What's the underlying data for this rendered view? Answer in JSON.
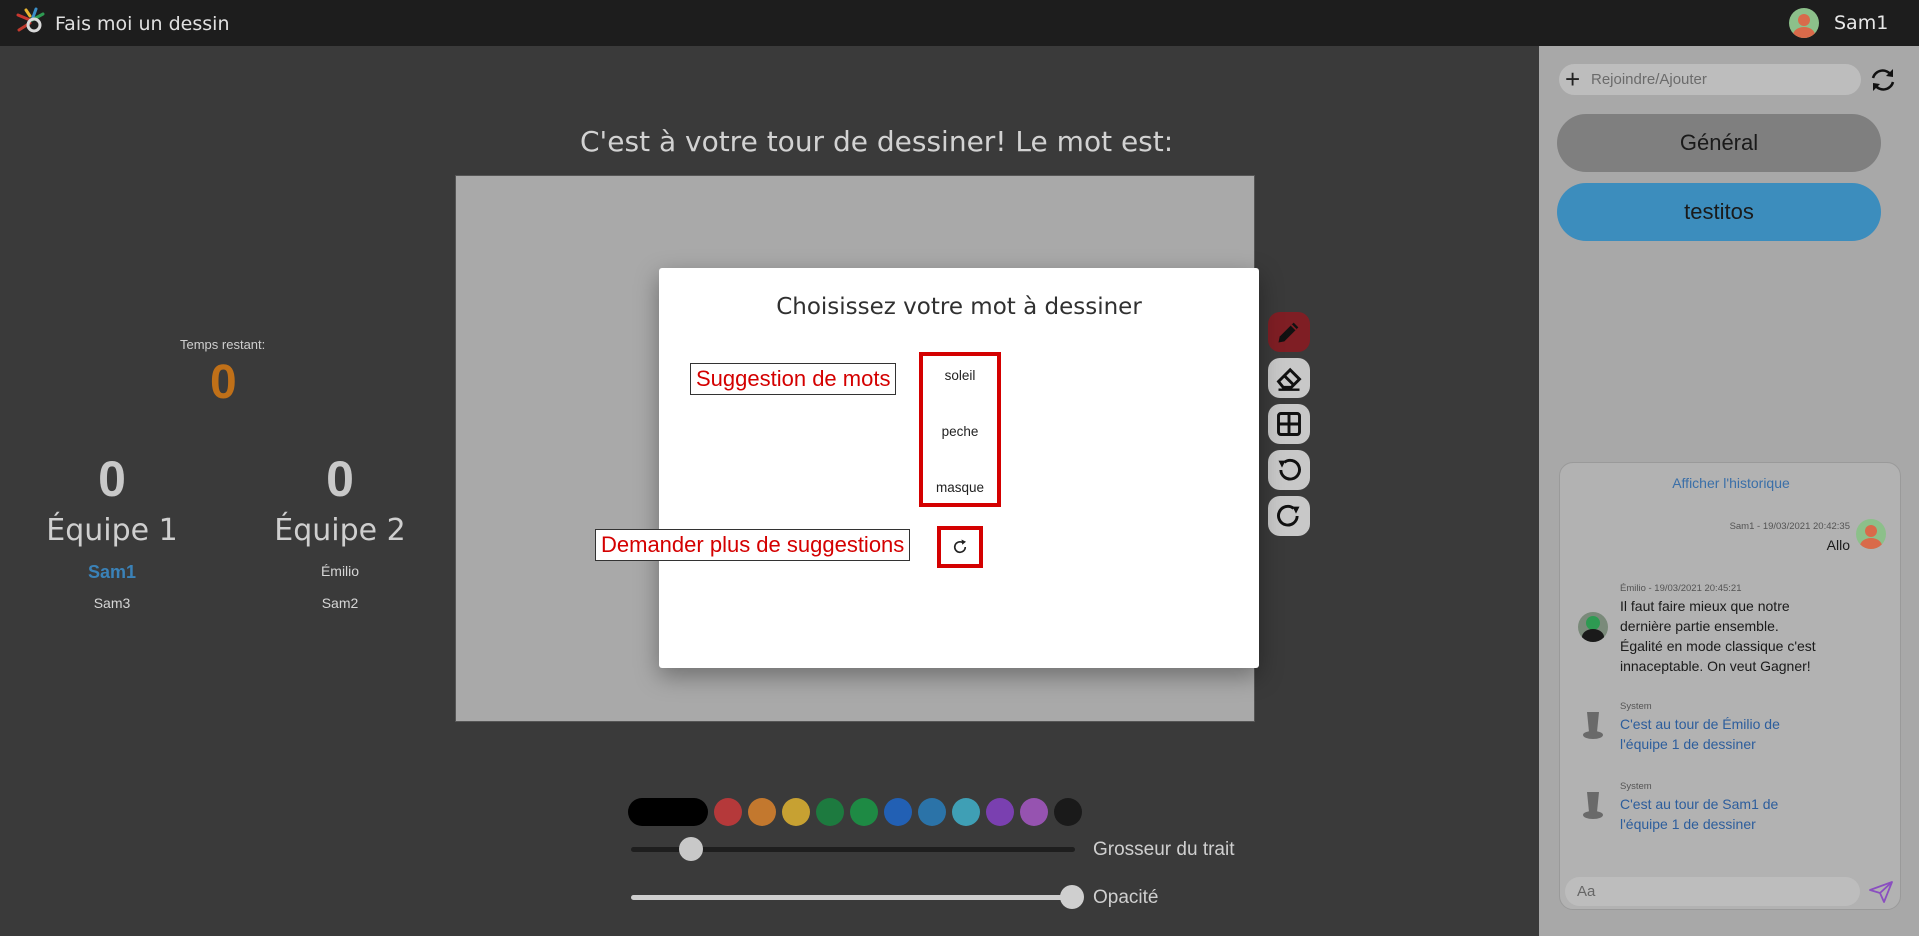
{
  "app": {
    "title": "Fais moi un dessin"
  },
  "user": {
    "name": "Sam1"
  },
  "game": {
    "turn_message": "C'est à votre tour de dessiner! Le mot est:",
    "timer_label": "Temps restant:",
    "timer_value": "0",
    "teams": [
      {
        "score": "0",
        "name": "Équipe 1",
        "players": [
          "Sam1",
          "Sam3"
        ]
      },
      {
        "score": "0",
        "name": "Équipe 2",
        "players": [
          "Émilio",
          "Sam2"
        ]
      }
    ]
  },
  "tools": {
    "items": [
      "pencil-icon",
      "eraser-icon",
      "grid-icon",
      "undo-icon",
      "redo-icon"
    ],
    "active": "pencil-icon"
  },
  "palette": {
    "colors": [
      "#000000",
      "#b5393a",
      "#c3782e",
      "#c7a132",
      "#1d7a3f",
      "#1e8a44",
      "#2260b4",
      "#2b73a8",
      "#3f9fb5",
      "#7a40b0",
      "#9653b0",
      "#1a1a1a"
    ]
  },
  "sliders": {
    "size_label": "Grosseur du trait",
    "size_value": 0.09,
    "opacity_label": "Opacité",
    "opacity_value": 1.0
  },
  "modal": {
    "title": "Choisissez votre mot à dessiner",
    "words": [
      "soleil",
      "peche",
      "masque"
    ],
    "callout_words": "Suggestion de mots",
    "callout_refresh": "Demander plus de suggestions"
  },
  "sidebar": {
    "join_placeholder": "Rejoindre/Ajouter",
    "channels": [
      "Général",
      "testitos"
    ]
  },
  "chat": {
    "history_link": "Afficher l'historique",
    "messages": [
      {
        "meta": "Sam1 - 19/03/2021 20:42:35",
        "text": "Allo"
      },
      {
        "meta": "Émilio - 19/03/2021 20:45:21",
        "lines": [
          "Il faut faire mieux que notre",
          "dernière partie ensemble.",
          "Égalité en mode classique c'est",
          "innaceptable. On veut Gagner!"
        ]
      },
      {
        "meta": "System",
        "lines": [
          "C'est au tour de Émilio de",
          "l'équipe 1 de dessiner"
        ]
      },
      {
        "meta": "System",
        "lines": [
          "C'est au tour de Sam1 de",
          "l'équipe 1 de dessiner"
        ]
      }
    ],
    "input_placeholder": "Aa"
  }
}
